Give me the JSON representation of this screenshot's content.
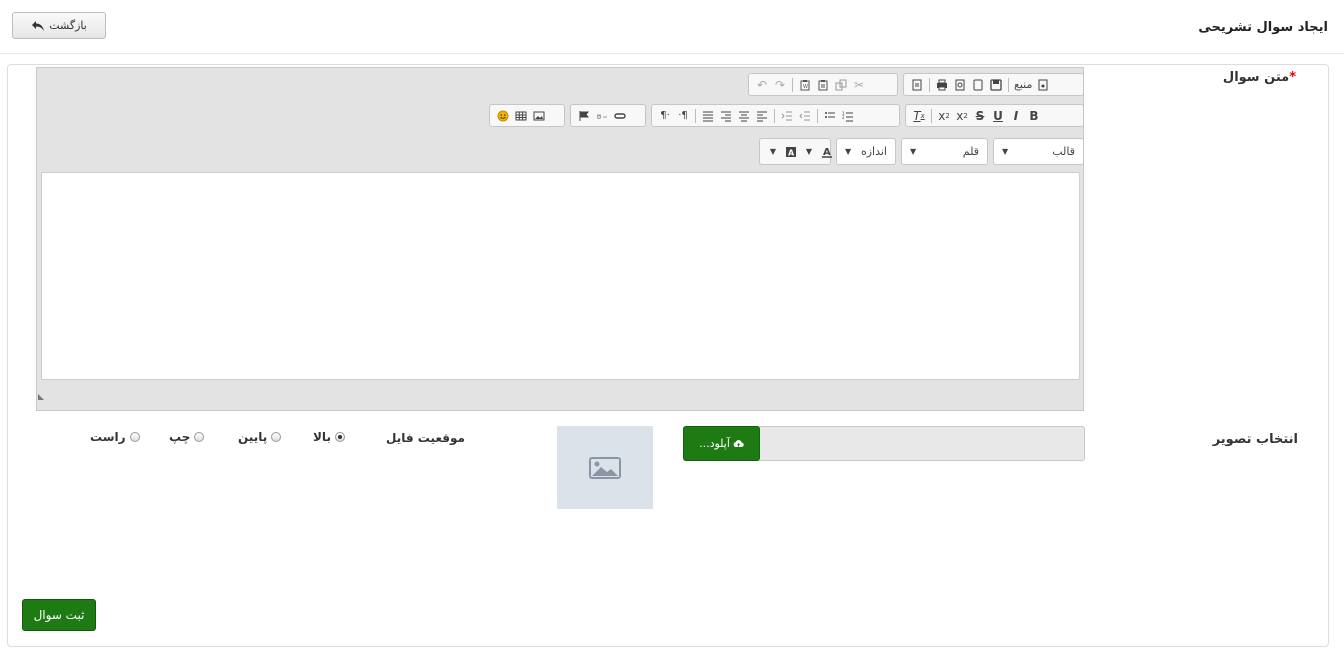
{
  "header": {
    "title": "ایجاد سوال تشریحی",
    "back_label": "بازگشت"
  },
  "form": {
    "question_label": "متن سوال",
    "required_mark": "*",
    "image_label": "انتخاب تصویر",
    "upload_label": "آپلود...",
    "file_position_label": "موقعیت فایل",
    "position_options": [
      {
        "label": "بالا",
        "checked": true
      },
      {
        "label": "پایین",
        "checked": false
      },
      {
        "label": "چپ",
        "checked": false
      },
      {
        "label": "راست",
        "checked": false
      }
    ],
    "submit_label": "ثبت سوال"
  },
  "editor": {
    "source_label": "منبع",
    "format_combo": "قالب",
    "font_combo": "قلم",
    "size_combo": "اندازه",
    "bold": "B",
    "italic": "I",
    "underline": "U",
    "strike": "S"
  },
  "colors": {
    "primary_green": "#1e7b14",
    "required_red": "#dd0000",
    "editor_bg": "#e3e3e3"
  }
}
